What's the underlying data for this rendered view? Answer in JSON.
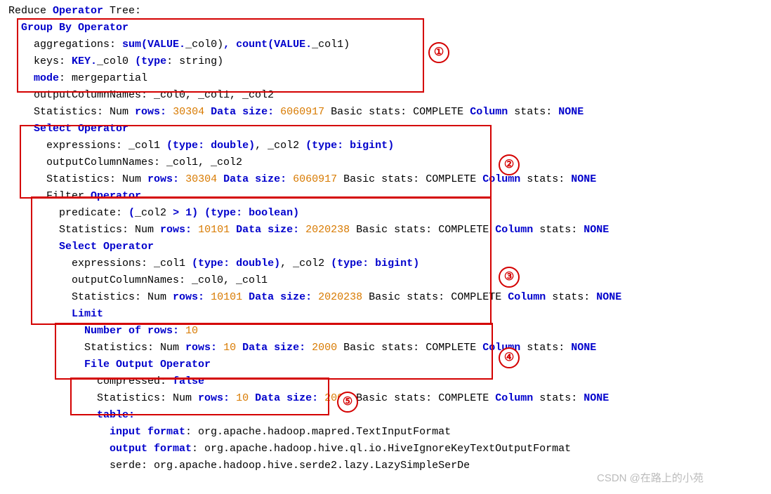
{
  "header": "Reduce",
  "header_op": "Operator",
  "header_suffix": " Tree:",
  "groupby": {
    "title": "Group By Operator",
    "agg_label": "aggregations:",
    "agg_func1": "sum(VALUE.",
    "agg_arg1": "_col0)",
    "agg_sep": ",",
    "agg_func2": "count(VALUE.",
    "agg_arg2": "_col1)",
    "keys_label": "keys:",
    "keys_key": "KEY.",
    "keys_col": "_col0",
    "keys_open": " (",
    "keys_type": "type",
    "keys_colon": ": string)",
    "mode_label": "mode",
    "mode_val": ": mergepartial",
    "out_label": "outputColumnNames: _col0, _col1, _col2",
    "stats_pre": "Statistics: Num ",
    "stats_rows": "rows",
    "stats_rows_val": " 30304 ",
    "stats_data": "Data",
    "stats_size": "size",
    "stats_size_val": " 6060917",
    "stats_basic": " Basic stats: COMPLETE ",
    "stats_col": "Column",
    "stats_stats": " stats: ",
    "stats_none": "NONE"
  },
  "select1": {
    "title": "Select Operator",
    "expr_label": "expressions: _col1 ",
    "expr_open": "(",
    "expr_type": "type",
    "expr_c1": ":",
    "expr_dbl": " double",
    "expr_close": ")",
    "expr_mid": ", _col2 ",
    "expr_bi": " bigint",
    "out_label": "outputColumnNames: _col1, _col2",
    "stats_pre": "Statistics: Num ",
    "stats_rows_val": " 30304 ",
    "stats_size_val": " 6060917",
    "stats_basic": " Basic stats:"
  },
  "filter": {
    "title_pre": "Filter ",
    "title_op": "Operator",
    "pred_label": "predicate: ",
    "pred_open": "(",
    "pred_col": "_col2 ",
    "pred_gt": "> 1",
    "pred_close": ") (",
    "pred_bool": " boolean",
    "stats_rows_val": " 10101 ",
    "stats_size_val": " 2020238"
  },
  "select2": {
    "title": "Select Operator",
    "expr_label": "expressions: _col1 ",
    "out_label": "outputColumnNames: _col0, _col1"
  },
  "limit": {
    "title": "Limit",
    "num_label": "Number of rows",
    "num_colon": ":",
    "num_val": " 10",
    "stats_rows_val": " 10 ",
    "stats_size_val": " 2000"
  },
  "fileout": {
    "title": "File Output Operator",
    "comp_label": "compressed: ",
    "comp_val": "false",
    "table": "table",
    "infmt_label": "input format",
    "infmt_val": ": org.apache.hadoop.mapred.TextInputFormat",
    "outfmt_label": "output format",
    "outfmt_val": ": org.apache.hadoop.hive.ql.io.HiveIgnoreKeyTextOutputFormat",
    "serde": "serde: org.apache.hadoop.hive.serde2.lazy.LazySimpleSerDe"
  },
  "common": {
    "complete": " COMPLETE ",
    "colon": ":"
  },
  "annotations": [
    "①",
    "②",
    "③",
    "④",
    "⑤"
  ],
  "watermark": "CSDN @在路上的小苑"
}
